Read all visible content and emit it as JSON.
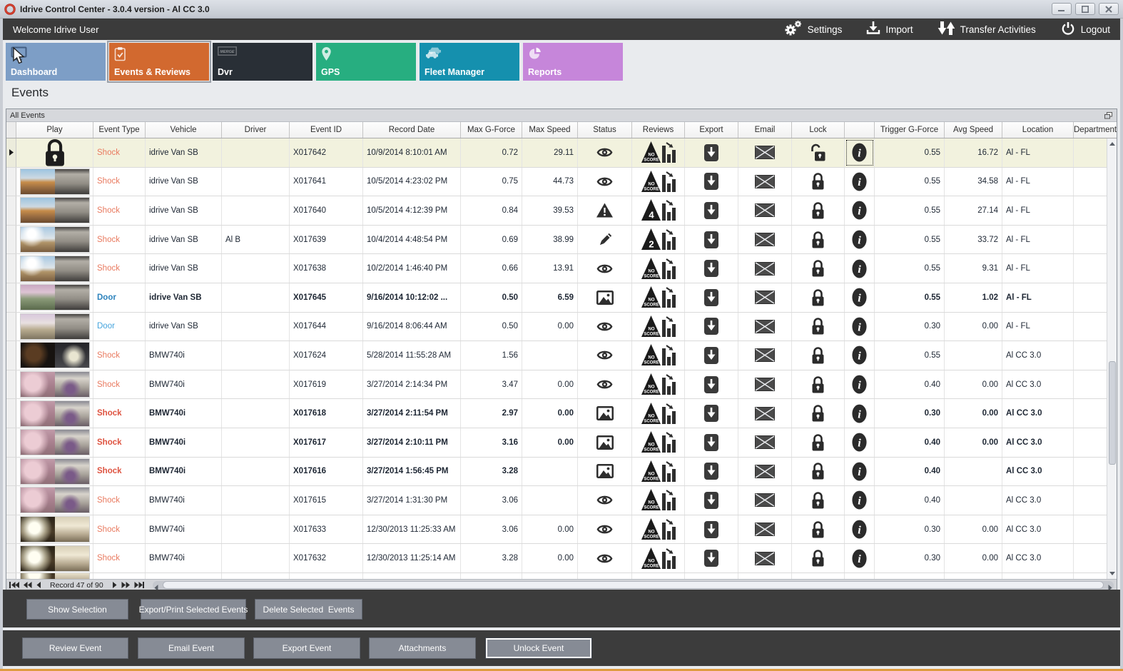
{
  "window": {
    "title": "Idrive Control Center - 3.0.4 version - Al CC 3.0"
  },
  "topbar": {
    "welcome": "Welcome Idrive User",
    "actions": [
      {
        "label": "Settings",
        "icon": "gears-icon"
      },
      {
        "label": "Import",
        "icon": "import-icon"
      },
      {
        "label": "Transfer Activities",
        "icon": "transfer-icon"
      },
      {
        "label": "Logout",
        "icon": "power-icon"
      }
    ]
  },
  "nav": {
    "tiles": [
      {
        "label": "Dashboard",
        "color": "#7d9ec6",
        "icon": "dashboard-icon",
        "selected": false
      },
      {
        "label": "Events & Reviews",
        "color": "#d2692f",
        "icon": "clipboard-check-icon",
        "selected": true
      },
      {
        "label": "Dvr",
        "color": "#292f36",
        "icon": "merge-badge-icon",
        "selected": false
      },
      {
        "label": "GPS",
        "color": "#27ae80",
        "icon": "map-pin-icon",
        "selected": false
      },
      {
        "label": "Fleet Manager",
        "color": "#1590ae",
        "icon": "vehicles-icon",
        "selected": false
      },
      {
        "label": "Reports",
        "color": "#c686da",
        "icon": "pie-chart-icon",
        "selected": false
      }
    ]
  },
  "page": {
    "heading": "Events",
    "panel_title": "All Events"
  },
  "table": {
    "columns": [
      {
        "key": "play",
        "label": "Play"
      },
      {
        "key": "type",
        "label": "Event Type"
      },
      {
        "key": "vehicle",
        "label": "Vehicle"
      },
      {
        "key": "driver",
        "label": "Driver"
      },
      {
        "key": "id",
        "label": "Event ID"
      },
      {
        "key": "date",
        "label": "Record Date"
      },
      {
        "key": "maxg",
        "label": "Max G-Force"
      },
      {
        "key": "maxs",
        "label": "Max Speed"
      },
      {
        "key": "status",
        "label": "Status"
      },
      {
        "key": "reviews",
        "label": "Reviews"
      },
      {
        "key": "export",
        "label": "Export"
      },
      {
        "key": "email",
        "label": "Email"
      },
      {
        "key": "lock",
        "label": "Lock"
      },
      {
        "key": "info",
        "label": ""
      },
      {
        "key": "trig",
        "label": "Trigger G-Force"
      },
      {
        "key": "avg",
        "label": "Avg Speed"
      },
      {
        "key": "loc",
        "label": "Location"
      },
      {
        "key": "dept",
        "label": "Department"
      }
    ],
    "rows": [
      {
        "selected": true,
        "play": "lock",
        "type": "Shock",
        "style": "shock",
        "vehicle": "idrive Van SB",
        "driver": "",
        "id": "X017642",
        "date": "10/9/2014 8:10:01 AM",
        "maxg": "0.72",
        "maxs": "29.11",
        "status": "eye",
        "review": "NO SCORE",
        "lock": "unlocked",
        "trig": "0.55",
        "avg": "16.72",
        "loc": "Al - FL",
        "focus_info": true
      },
      {
        "thumb": "road1",
        "type": "Shock",
        "style": "shock",
        "vehicle": "idrive Van SB",
        "driver": "",
        "id": "X017641",
        "date": "10/5/2014 4:23:02 PM",
        "maxg": "0.75",
        "maxs": "44.73",
        "status": "eye",
        "review": "NO SCORE",
        "lock": "locked",
        "trig": "0.55",
        "avg": "34.58",
        "loc": "Al - FL"
      },
      {
        "thumb": "road1",
        "type": "Shock",
        "style": "shock",
        "vehicle": "idrive Van SB",
        "driver": "",
        "id": "X017640",
        "date": "10/5/2014 4:12:39 PM",
        "maxg": "0.84",
        "maxs": "39.53",
        "status": "warning",
        "review": "4",
        "lock": "locked",
        "trig": "0.55",
        "avg": "27.14",
        "loc": "Al - FL"
      },
      {
        "thumb": "road2",
        "type": "Shock",
        "style": "shock",
        "vehicle": "idrive Van SB",
        "driver": "Al B",
        "id": "X017639",
        "date": "10/4/2014 4:48:54 PM",
        "maxg": "0.69",
        "maxs": "38.99",
        "status": "pencil",
        "review": "2",
        "lock": "locked",
        "trig": "0.55",
        "avg": "33.72",
        "loc": "Al - FL"
      },
      {
        "thumb": "road2",
        "type": "Shock",
        "style": "shock",
        "vehicle": "idrive Van SB",
        "driver": "",
        "id": "X017638",
        "date": "10/2/2014 1:46:40 PM",
        "maxg": "0.66",
        "maxs": "13.91",
        "status": "eye",
        "review": "NO SCORE",
        "lock": "locked",
        "trig": "0.55",
        "avg": "9.31",
        "loc": "Al - FL"
      },
      {
        "bold": true,
        "thumb": "trees",
        "type": "Door",
        "style": "door",
        "vehicle": "idrive Van SB",
        "driver": "",
        "id": "X017645",
        "date": "9/16/2014 10:12:02 ...",
        "maxg": "0.50",
        "maxs": "6.59",
        "status": "photo",
        "review": "NO SCORE",
        "lock": "locked",
        "trig": "0.55",
        "avg": "1.02",
        "loc": "Al - FL"
      },
      {
        "thumb": "trees2",
        "type": "Door",
        "style": "door",
        "vehicle": "idrive Van SB",
        "driver": "",
        "id": "X017644",
        "date": "9/16/2014 8:06:44 AM",
        "maxg": "0.50",
        "maxs": "0.00",
        "status": "eye",
        "review": "NO SCORE",
        "lock": "locked",
        "trig": "0.30",
        "avg": "0.00",
        "loc": "Al - FL"
      },
      {
        "thumb": "darkroom",
        "type": "Shock",
        "style": "shock",
        "vehicle": "BMW740i",
        "driver": "",
        "id": "X017624",
        "date": "5/28/2014 11:55:28 AM",
        "maxg": "1.56",
        "maxs": "",
        "status": "eye",
        "review": "NO SCORE",
        "lock": "locked",
        "trig": "0.55",
        "avg": "",
        "loc": "Al CC 3.0"
      },
      {
        "thumb": "pink",
        "type": "Shock",
        "style": "shock",
        "vehicle": "BMW740i",
        "driver": "",
        "id": "X017619",
        "date": "3/27/2014 2:14:34 PM",
        "maxg": "3.47",
        "maxs": "0.00",
        "status": "eye",
        "review": "NO SCORE",
        "lock": "locked",
        "trig": "0.40",
        "avg": "0.00",
        "loc": "Al CC 3.0"
      },
      {
        "bold": true,
        "thumb": "pink",
        "type": "Shock",
        "style": "shock",
        "vehicle": "BMW740i",
        "driver": "",
        "id": "X017618",
        "date": "3/27/2014 2:11:54 PM",
        "maxg": "2.97",
        "maxs": "0.00",
        "status": "photo",
        "review": "NO SCORE",
        "lock": "locked",
        "trig": "0.30",
        "avg": "0.00",
        "loc": "Al CC 3.0"
      },
      {
        "bold": true,
        "thumb": "pink",
        "type": "Shock",
        "style": "shock",
        "vehicle": "BMW740i",
        "driver": "",
        "id": "X017617",
        "date": "3/27/2014 2:10:11 PM",
        "maxg": "3.16",
        "maxs": "0.00",
        "status": "photo",
        "review": "NO SCORE",
        "lock": "locked",
        "trig": "0.40",
        "avg": "0.00",
        "loc": "Al CC 3.0"
      },
      {
        "bold": true,
        "thumb": "pink",
        "type": "Shock",
        "style": "shock",
        "vehicle": "BMW740i",
        "driver": "",
        "id": "X017616",
        "date": "3/27/2014 1:56:45 PM",
        "maxg": "3.28",
        "maxs": "",
        "status": "photo",
        "review": "NO SCORE",
        "lock": "locked",
        "trig": "0.40",
        "avg": "",
        "loc": "Al CC 3.0"
      },
      {
        "thumb": "pink",
        "type": "Shock",
        "style": "shock",
        "vehicle": "BMW740i",
        "driver": "",
        "id": "X017615",
        "date": "3/27/2014 1:31:30 PM",
        "maxg": "3.06",
        "maxs": "",
        "status": "eye",
        "review": "NO SCORE",
        "lock": "locked",
        "trig": "0.40",
        "avg": "",
        "loc": "Al CC 3.0"
      },
      {
        "thumb": "lightroom",
        "type": "Shock",
        "style": "shock",
        "vehicle": "BMW740i",
        "driver": "",
        "id": "X017633",
        "date": "12/30/2013 11:25:33 AM",
        "maxg": "3.06",
        "maxs": "0.00",
        "status": "eye",
        "review": "NO SCORE",
        "lock": "locked",
        "trig": "0.30",
        "avg": "0.00",
        "loc": "Al CC 3.0"
      },
      {
        "thumb": "lightroom",
        "type": "Shock",
        "style": "shock",
        "vehicle": "BMW740i",
        "driver": "",
        "id": "X017632",
        "date": "12/30/2013 11:25:14 AM",
        "maxg": "3.28",
        "maxs": "0.00",
        "status": "eye",
        "review": "NO SCORE",
        "lock": "locked",
        "trig": "0.30",
        "avg": "0.00",
        "loc": "Al CC 3.0"
      },
      {
        "partial": true,
        "thumb": "lightroom",
        "type": "",
        "style": "shock",
        "vehicle": "",
        "driver": "",
        "id": "",
        "date": "",
        "maxg": "",
        "maxs": "",
        "trig": "",
        "avg": "",
        "loc": ""
      }
    ]
  },
  "navigator": {
    "record_text": "Record 47 of 90"
  },
  "selection_actions": [
    "Show Selection",
    "Export/Print Selected Events",
    "Delete Selected  Events"
  ],
  "event_actions": [
    "Review Event",
    "Email Event",
    "Export Event",
    "Attachments",
    "Unlock Event"
  ],
  "colors": {
    "accent_orange": "#de9b3f",
    "selected_row": "#f2f2de",
    "dark_bar": "#3c3c3c"
  }
}
